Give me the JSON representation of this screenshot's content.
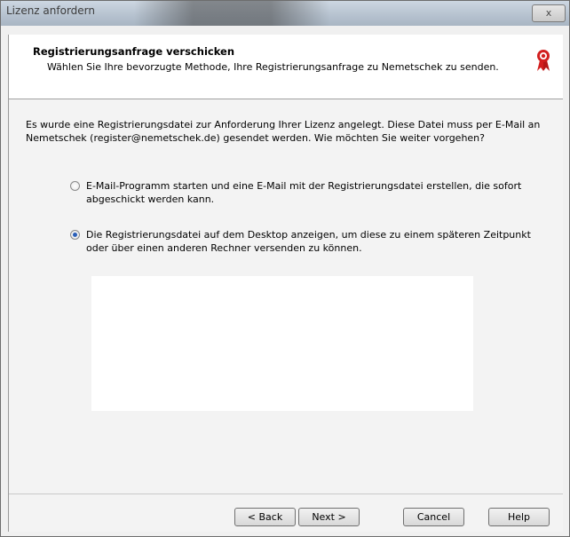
{
  "window": {
    "title": "Lizenz anfordern",
    "close_label": "x"
  },
  "header": {
    "title": "Registrierungsanfrage verschicken",
    "subtitle": "Wählen Sie Ihre bevorzugte Methode, Ihre Registrierungsanfrage zu Nemetschek zu senden."
  },
  "body": {
    "intro": "Es wurde eine Registrierungsdatei zur Anforderung Ihrer Lizenz angelegt. Diese Datei muss  per E-Mail an Nemetschek (register@nemetschek.de) gesendet werden. Wie möchten Sie weiter vorgehen?",
    "options": [
      {
        "label": "E-Mail-Programm starten und eine E-Mail mit der Registrierungsdatei erstellen, die sofort abgeschickt werden kann.",
        "selected": false
      },
      {
        "label": "Die Registrierungsdatei auf dem Desktop anzeigen, um diese zu einem späteren Zeitpunkt oder über einen anderen Rechner versenden zu können.",
        "selected": true
      }
    ]
  },
  "buttons": {
    "back": "< Back",
    "next": "Next >",
    "cancel": "Cancel",
    "help": "Help"
  },
  "icons": {
    "header_icon": "award-ribbon-icon",
    "accent_color": "#d21f1f"
  }
}
